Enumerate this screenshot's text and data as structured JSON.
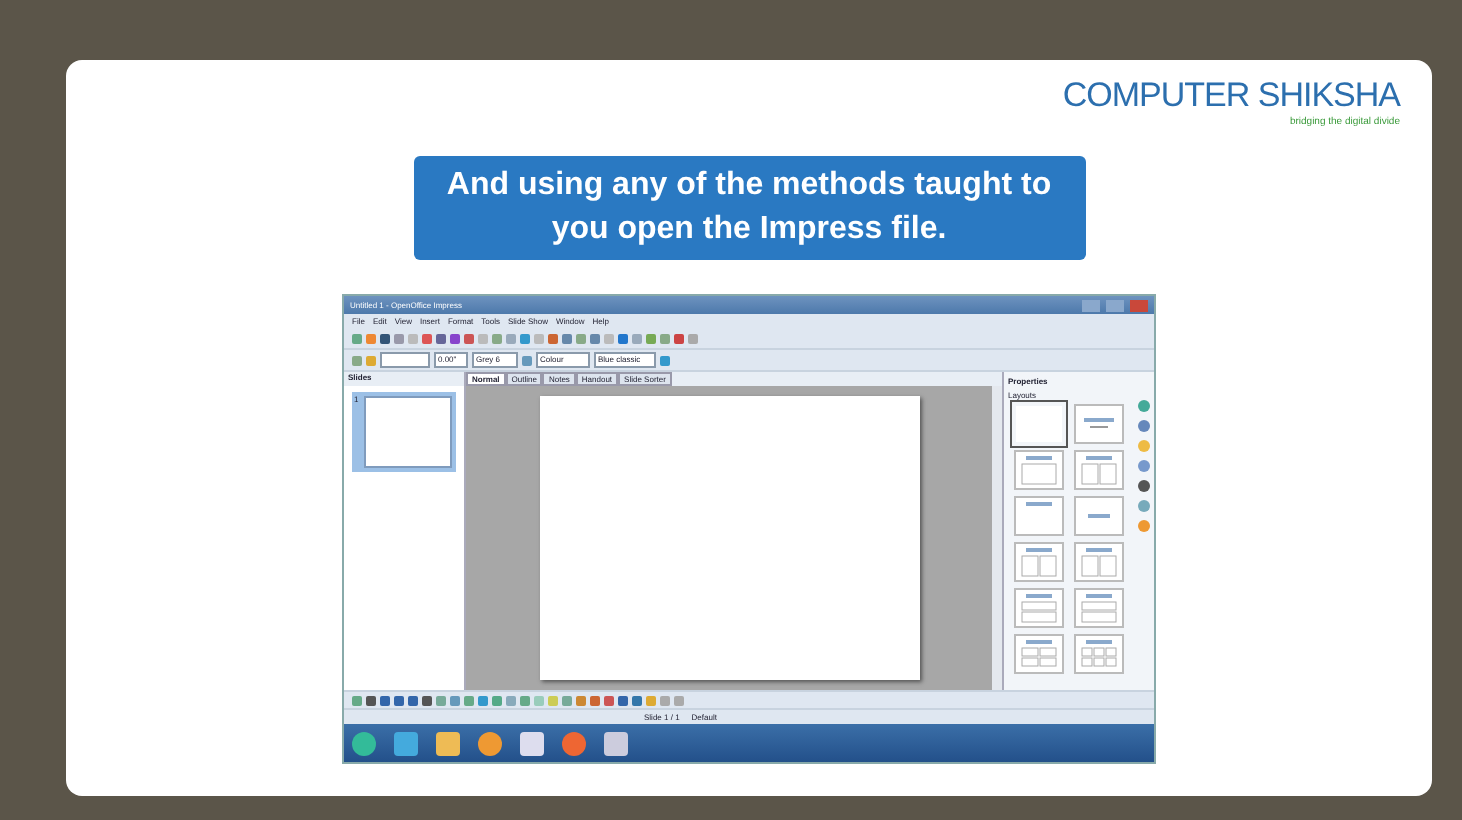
{
  "slide": {
    "logo": {
      "name": "COMPUTER SHIKSHA",
      "tagline": "bridging the digital divide"
    },
    "banner": "And using any of the methods taught to you open the Impress file."
  },
  "app": {
    "title": "Untitled 1 - OpenOffice Impress",
    "menu": [
      "File",
      "Edit",
      "View",
      "Insert",
      "Format",
      "Tools",
      "Slide Show",
      "Window",
      "Help"
    ],
    "toolbar": {
      "line_width": "0.00\"",
      "line_color": "Grey 6",
      "area_style": "Colour",
      "area_color": "Blue classic"
    },
    "slides_pane": {
      "title": "Slides",
      "thumbnails": [
        {
          "number": "1",
          "selected": true
        }
      ]
    },
    "tabs": [
      {
        "label": "Normal",
        "selected": true
      },
      {
        "label": "Outline",
        "selected": false
      },
      {
        "label": "Notes",
        "selected": false
      },
      {
        "label": "Handout",
        "selected": false
      },
      {
        "label": "Slide Sorter",
        "selected": false
      }
    ],
    "sidebar": {
      "title": "Properties",
      "section": "Layouts",
      "layouts": [
        {
          "kind": "blank",
          "selected": true
        },
        {
          "kind": "title",
          "selected": false
        },
        {
          "kind": "content",
          "selected": false
        },
        {
          "kind": "two",
          "selected": false
        },
        {
          "kind": "titleonly",
          "selected": false
        },
        {
          "kind": "centered",
          "selected": false
        },
        {
          "kind": "two",
          "selected": false
        },
        {
          "kind": "two",
          "selected": false
        },
        {
          "kind": "rows",
          "selected": false
        },
        {
          "kind": "rows",
          "selected": false
        },
        {
          "kind": "four",
          "selected": false
        },
        {
          "kind": "six",
          "selected": false
        }
      ]
    },
    "status": {
      "slide": "Slide 1 / 1",
      "master": "Default"
    }
  }
}
